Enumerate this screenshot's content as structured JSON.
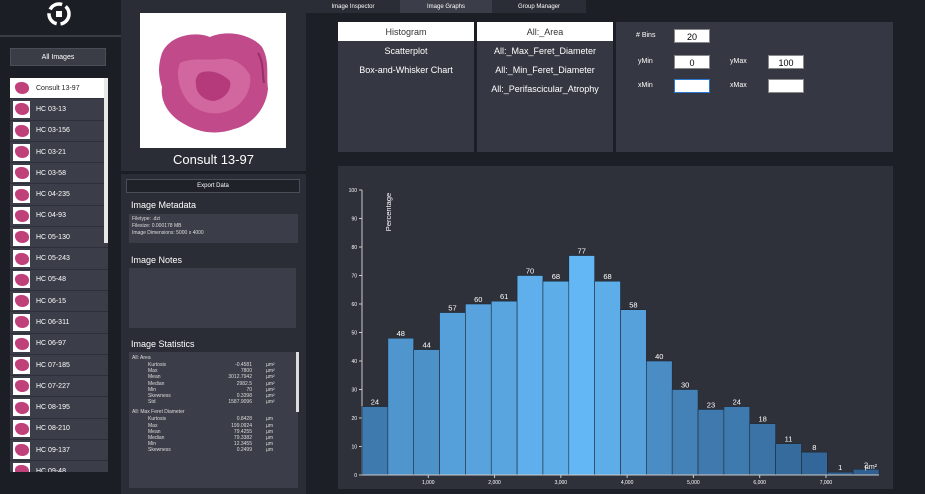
{
  "sidebar": {
    "all_images_label": "All Images",
    "images": [
      {
        "name": "Consult 13-97",
        "active": true
      },
      {
        "name": "HC 03-13"
      },
      {
        "name": "HC 03-156"
      },
      {
        "name": "HC 03-21"
      },
      {
        "name": "HC 03-58"
      },
      {
        "name": "HC 04-235"
      },
      {
        "name": "HC 04-93"
      },
      {
        "name": "HC 05-130"
      },
      {
        "name": "HC 05-243"
      },
      {
        "name": "HC 05-48"
      },
      {
        "name": "HC 06-15"
      },
      {
        "name": "HC 06-311"
      },
      {
        "name": "HC 06-97"
      },
      {
        "name": "HC 07-185"
      },
      {
        "name": "HC 07-227"
      },
      {
        "name": "HC 08-195"
      },
      {
        "name": "HC 08-210"
      },
      {
        "name": "HC 09-137"
      },
      {
        "name": "HC 09-48"
      }
    ]
  },
  "details": {
    "title": "Consult 13-97",
    "export_label": "Export Data",
    "metadata_title": "Image Metadata",
    "metadata_lines": [
      "Filetype: .dzi",
      "Filesize: 0.000178 MB",
      "Image Dimensions: 5000 x 4000"
    ],
    "notes_title": "Image Notes",
    "stats_title": "Image Statistics",
    "stats_groups": [
      {
        "name": "All: Area",
        "rows": [
          {
            "n": "Kurtosis",
            "v": "-0.4581",
            "u": "µm²"
          },
          {
            "n": "Max",
            "v": "7800",
            "u": "µm²"
          },
          {
            "n": "Mean",
            "v": "3012.7942",
            "u": "µm²"
          },
          {
            "n": "Median",
            "v": "2982.5",
            "u": "µm²"
          },
          {
            "n": "Min",
            "v": "70",
            "u": "µm²"
          },
          {
            "n": "Skewness",
            "v": "0.3398",
            "u": "µm²"
          },
          {
            "n": "Std",
            "v": "1587.9096",
            "u": "µm²"
          }
        ]
      },
      {
        "name": "All: Max Feret Diameter",
        "rows": [
          {
            "n": "Kurtosis",
            "v": "0.8428",
            "u": "µm"
          },
          {
            "n": "Max",
            "v": "199.0924",
            "u": "µm"
          },
          {
            "n": "Mean",
            "v": "79.4255",
            "u": "µm"
          },
          {
            "n": "Median",
            "v": "79.3382",
            "u": "µm"
          },
          {
            "n": "Min",
            "v": "12.3455",
            "u": "µm"
          },
          {
            "n": "Skewness",
            "v": "0.2499",
            "u": "µm"
          }
        ]
      }
    ]
  },
  "tabs": [
    {
      "label": "Image Inspector",
      "active": false
    },
    {
      "label": "Image Graphs",
      "active": true
    },
    {
      "label": "Group Manager",
      "active": false
    }
  ],
  "graph_types": [
    {
      "label": "Histogram",
      "selected": true
    },
    {
      "label": "Scatterplot"
    },
    {
      "label": "Box-and-Whisker Chart"
    }
  ],
  "measures": [
    {
      "label": "All:_Area",
      "selected": true
    },
    {
      "label": "All:_Max_Feret_Diameter"
    },
    {
      "label": "All:_Min_Feret_Diameter"
    },
    {
      "label": "All:_Perifascicular_Atrophy"
    }
  ],
  "controls": {
    "bins_label": "# Bins",
    "bins_value": "20",
    "ymin_label": "yMin",
    "ymin_value": "0",
    "ymax_label": "yMax",
    "ymax_value": "100",
    "xmin_label": "xMin",
    "xmin_value": "",
    "xmax_label": "xMax",
    "xmax_value": ""
  },
  "chart_data": {
    "type": "bar",
    "ylabel": "Percentage",
    "x_unit_label": "µm²",
    "ylim": [
      0,
      100
    ],
    "xlim": [
      0,
      7800
    ],
    "y_ticks": [
      0,
      10,
      20,
      30,
      40,
      50,
      60,
      70,
      80,
      90,
      100
    ],
    "x_ticks": [
      1000,
      2000,
      3000,
      4000,
      5000,
      6000,
      7000
    ],
    "x_tick_labels": [
      "1,000",
      "2,000",
      "3,000",
      "4,000",
      "5,000",
      "6,000",
      "7,000"
    ],
    "bin_start": 0,
    "bin_width": 390,
    "values": [
      24,
      48,
      44,
      57,
      60,
      61,
      70,
      68,
      77,
      68,
      58,
      40,
      30,
      23,
      24,
      18,
      11,
      8,
      1,
      2
    ],
    "colors": {
      "low": "#2f5e8e",
      "high": "#63b7f5"
    }
  }
}
